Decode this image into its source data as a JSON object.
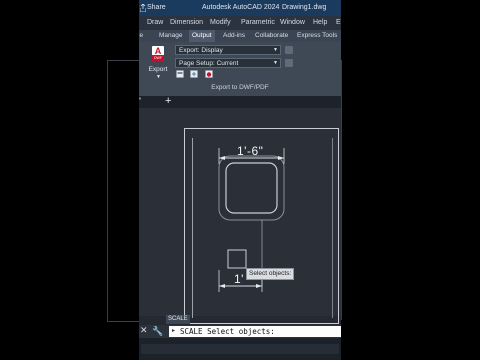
{
  "titlebar": {
    "share_label": "Share",
    "app_title": "Autodesk AutoCAD 2024",
    "document": "Drawing1.dwg"
  },
  "menubar": {
    "items": [
      "Draw",
      "Dimension",
      "Modify",
      "Parametric",
      "Window",
      "Help",
      "E"
    ]
  },
  "ribbon_tabs": {
    "items": [
      "ie",
      "Manage",
      "Output",
      "Add-ins",
      "Collaborate",
      "Express Tools"
    ],
    "active": "Output"
  },
  "ribbon": {
    "export_button": {
      "label": "Export",
      "logo_letter": "A",
      "logo_sub": "DWF",
      "icon": "autocad-export-icon"
    },
    "export_dropdown": "Export: Display",
    "page_setup_dropdown": "Page Setup: Current",
    "panel_label": "Export to DWF/PDF"
  },
  "file_tabs": {
    "current_tab_fragment": "y*",
    "add_icon": "plus-icon"
  },
  "drawing": {
    "top_dimension": "1'-6\"",
    "bottom_dimension": "1'"
  },
  "tooltip": "Select objects:",
  "command_tag": "SCALE",
  "command_line": {
    "prompt": "SCALE Select objects:",
    "close_icon": "close-icon",
    "customize_icon": "wrench-icon"
  },
  "colors": {
    "titlebar": "#1b3b5e",
    "canvas": "#2a2f38",
    "ribbon": "#3f4855",
    "autocad_red": "#c8102e"
  }
}
